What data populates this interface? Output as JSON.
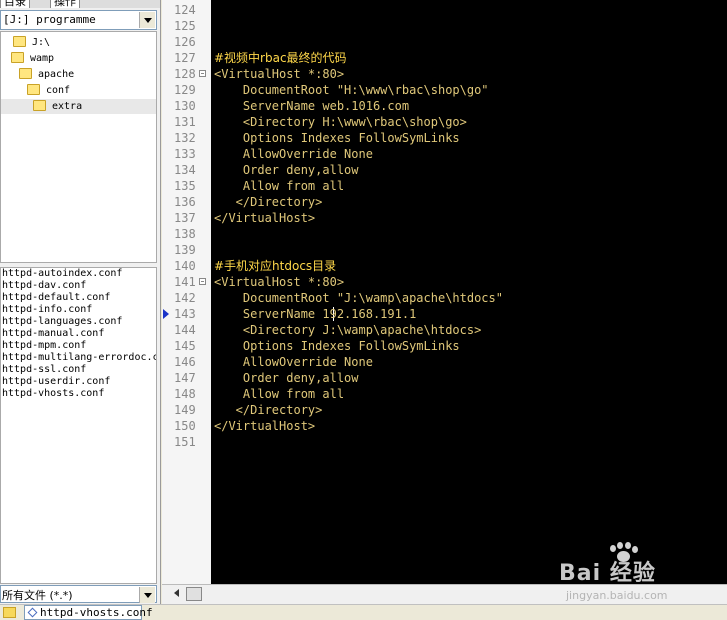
{
  "left_panel": {
    "tabs": [
      "目录",
      "操作"
    ],
    "drive": "[J:] programme",
    "folders": [
      {
        "label": "J:\\",
        "selected": false
      },
      {
        "label": "wamp",
        "selected": false
      },
      {
        "label": "apache",
        "selected": false
      },
      {
        "label": "conf",
        "selected": false
      },
      {
        "label": "extra",
        "selected": true
      }
    ],
    "files": [
      "httpd-autoindex.conf",
      "httpd-dav.conf",
      "httpd-default.conf",
      "httpd-info.conf",
      "httpd-languages.conf",
      "httpd-manual.conf",
      "httpd-mpm.conf",
      "httpd-multilang-errordoc.conf",
      "httpd-ssl.conf",
      "httpd-userdir.conf",
      "httpd-vhosts.conf"
    ],
    "filter": "所有文件 (*.*)"
  },
  "editor": {
    "lines": [
      {
        "num": "124",
        "text": "",
        "kind": "plain",
        "fold": false,
        "marker": false
      },
      {
        "num": "125",
        "text": "",
        "kind": "plain",
        "fold": false,
        "marker": false
      },
      {
        "num": "126",
        "text": "",
        "kind": "plain",
        "fold": false,
        "marker": false
      },
      {
        "num": "127",
        "text": "#视频中rbac最终的代码",
        "kind": "comment",
        "fold": false,
        "marker": false
      },
      {
        "num": "128",
        "text": "<VirtualHost *:80>",
        "kind": "plain",
        "fold": true,
        "marker": false
      },
      {
        "num": "129",
        "text": "    DocumentRoot \"H:\\www\\rbac\\shop\\go\"",
        "kind": "plain",
        "fold": false,
        "marker": false
      },
      {
        "num": "130",
        "text": "    ServerName web.1016.com",
        "kind": "plain",
        "fold": false,
        "marker": false
      },
      {
        "num": "131",
        "text": "    <Directory H:\\www\\rbac\\shop\\go>",
        "kind": "plain",
        "fold": false,
        "marker": false
      },
      {
        "num": "132",
        "text": "    Options Indexes FollowSymLinks",
        "kind": "plain",
        "fold": false,
        "marker": false
      },
      {
        "num": "133",
        "text": "    AllowOverride None",
        "kind": "plain",
        "fold": false,
        "marker": false
      },
      {
        "num": "134",
        "text": "    Order deny,allow",
        "kind": "plain",
        "fold": false,
        "marker": false
      },
      {
        "num": "135",
        "text": "    Allow from all",
        "kind": "plain",
        "fold": false,
        "marker": false
      },
      {
        "num": "136",
        "text": "   </Directory>",
        "kind": "plain",
        "fold": false,
        "marker": false
      },
      {
        "num": "137",
        "text": "</VirtualHost>",
        "kind": "plain",
        "fold": false,
        "marker": false
      },
      {
        "num": "138",
        "text": "",
        "kind": "plain",
        "fold": false,
        "marker": false
      },
      {
        "num": "139",
        "text": "",
        "kind": "plain",
        "fold": false,
        "marker": false
      },
      {
        "num": "140",
        "text": "#手机对应htdocs目录",
        "kind": "comment",
        "fold": false,
        "marker": false
      },
      {
        "num": "141",
        "text": "<VirtualHost *:80>",
        "kind": "plain",
        "fold": true,
        "marker": false
      },
      {
        "num": "142",
        "text": "    DocumentRoot \"J:\\wamp\\apache\\htdocs\"",
        "kind": "plain",
        "fold": false,
        "marker": false
      },
      {
        "num": "143",
        "text": "    ServerName 192.168.191.1",
        "kind": "plain",
        "fold": false,
        "marker": true
      },
      {
        "num": "144",
        "text": "    <Directory J:\\wamp\\apache\\htdocs>",
        "kind": "plain",
        "fold": false,
        "marker": false
      },
      {
        "num": "145",
        "text": "    Options Indexes FollowSymLinks",
        "kind": "plain",
        "fold": false,
        "marker": false
      },
      {
        "num": "146",
        "text": "    AllowOverride None",
        "kind": "plain",
        "fold": false,
        "marker": false
      },
      {
        "num": "147",
        "text": "    Order deny,allow",
        "kind": "plain",
        "fold": false,
        "marker": false
      },
      {
        "num": "148",
        "text": "    Allow from all",
        "kind": "plain",
        "fold": false,
        "marker": false
      },
      {
        "num": "149",
        "text": "   </Directory>",
        "kind": "plain",
        "fold": false,
        "marker": false
      },
      {
        "num": "150",
        "text": "</VirtualHost>",
        "kind": "plain",
        "fold": false,
        "marker": false
      },
      {
        "num": "151",
        "text": "",
        "kind": "plain",
        "fold": false,
        "marker": false
      }
    ]
  },
  "doc_tab": {
    "label": "httpd-vhosts.conf"
  },
  "watermark": {
    "logo_text": "Bai 经验",
    "url": "jingyan.baidu.com"
  }
}
